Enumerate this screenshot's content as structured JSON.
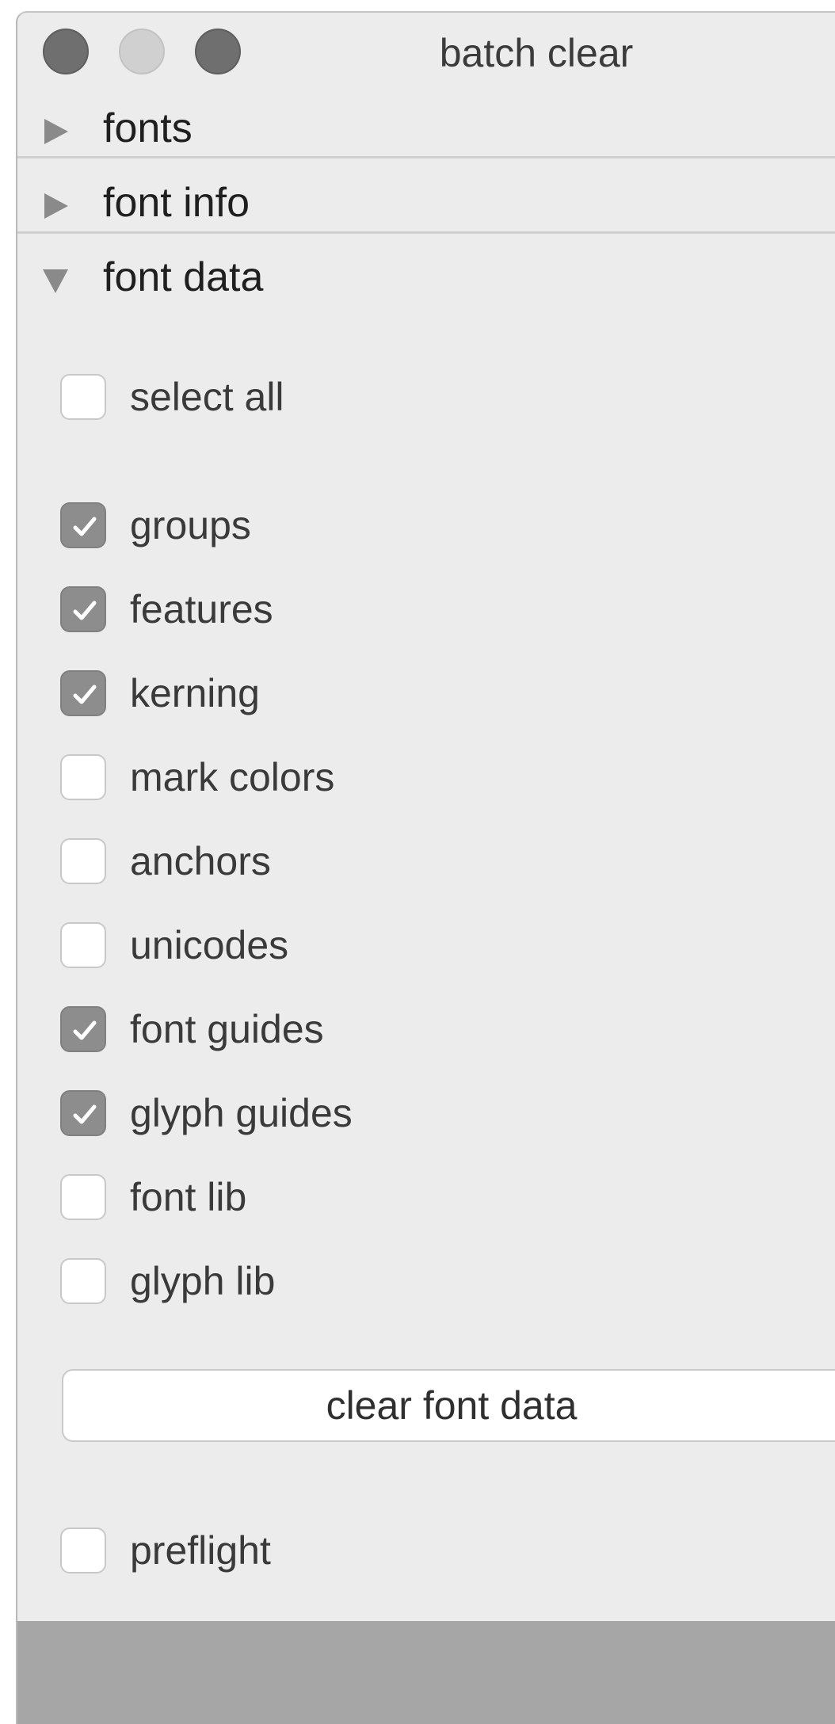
{
  "window": {
    "title": "batch clear"
  },
  "sections": [
    {
      "label": "fonts",
      "expanded": false
    },
    {
      "label": "font info",
      "expanded": false
    },
    {
      "label": "font data",
      "expanded": true
    }
  ],
  "font_data": {
    "select_all": {
      "label": "select all",
      "checked": false
    },
    "options": [
      {
        "label": "groups",
        "checked": true
      },
      {
        "label": "features",
        "checked": true
      },
      {
        "label": "kerning",
        "checked": true
      },
      {
        "label": "mark colors",
        "checked": false
      },
      {
        "label": "anchors",
        "checked": false
      },
      {
        "label": "unicodes",
        "checked": false
      },
      {
        "label": "font guides",
        "checked": true
      },
      {
        "label": "glyph guides",
        "checked": true
      },
      {
        "label": "font lib",
        "checked": false
      },
      {
        "label": "glyph lib",
        "checked": false
      }
    ],
    "clear_button_label": "clear font data",
    "preflight": {
      "label": "preflight",
      "checked": false
    }
  },
  "icons": {
    "collapsed": "triangle-right-icon",
    "expanded": "triangle-down-icon",
    "check": "checkmark-icon"
  },
  "colors": {
    "window_bg": "#ececec",
    "checked_box": "#8d8d8d",
    "bottom_bar": "#a6a6a6"
  }
}
